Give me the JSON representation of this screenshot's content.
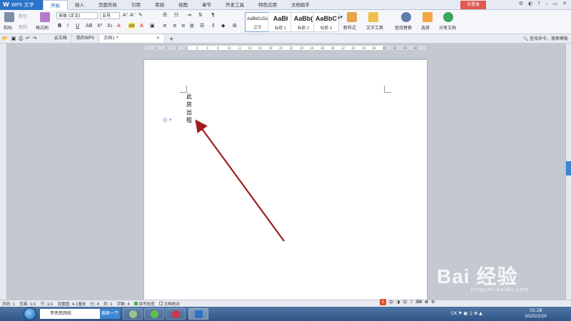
{
  "app": {
    "name": "WPS 文字",
    "login_label": "未登录"
  },
  "menu_tabs": [
    "开始",
    "插入",
    "页面布局",
    "引用",
    "审阅",
    "视图",
    "章节",
    "开发工具",
    "特色应用",
    "文档助手"
  ],
  "ribbon": {
    "paste": "粘贴",
    "cut": "剪切",
    "copy": "复制",
    "format_painter": "格式刷",
    "font_name": "宋体 (正文)",
    "font_size": "五号",
    "styles": [
      {
        "sample": "AaBbCcDd",
        "label": "正文"
      },
      {
        "sample": "AaBł",
        "label": "标题 1"
      },
      {
        "sample": "AaBb(",
        "label": "标题 2"
      },
      {
        "sample": "AaBbC",
        "label": "标题 3"
      }
    ],
    "new_style": "新样式",
    "text_tools": "文字工具",
    "find_replace": "查找替换",
    "select": "选择",
    "share": "分享文档"
  },
  "quickbar": {
    "doc_tabs": [
      "云文档",
      "我的WPS",
      "文档1 *"
    ],
    "right_tools": "查找命令、搜索模板"
  },
  "document": {
    "vertical_text": [
      "此",
      "房",
      "出",
      "租"
    ]
  },
  "ruler_ticks": [
    "6",
    "4",
    "2",
    "2",
    "4",
    "6",
    "8",
    "10",
    "12",
    "14",
    "16",
    "18",
    "20",
    "22",
    "24",
    "26",
    "28",
    "30",
    "32",
    "34",
    "36",
    "38",
    "40",
    "42",
    "44",
    "46"
  ],
  "status_bar": {
    "page_no": "页码: 1",
    "pages": "页面: 1/1",
    "section": "节: 1/1",
    "setting": "设置值: 4.1厘米",
    "row": "行: 4",
    "col": "列: 1",
    "words": "字数: 4",
    "spell_check": "拼写检查",
    "doc_check": "文档校对"
  },
  "ime_bar": {
    "logo": "S",
    "mode": "中"
  },
  "taskbar": {
    "search_text": "李亮思网校",
    "search_button": "搜索一下",
    "lang": "CK",
    "time": "15:28",
    "date": "2020/3/20"
  },
  "watermark": {
    "main": "Bai 经验",
    "sub": "jingyan.baidu.com"
  },
  "colors": {
    "accent": "#2b73c8",
    "arrow": "#a01c1c",
    "login": "#e05a4f"
  }
}
